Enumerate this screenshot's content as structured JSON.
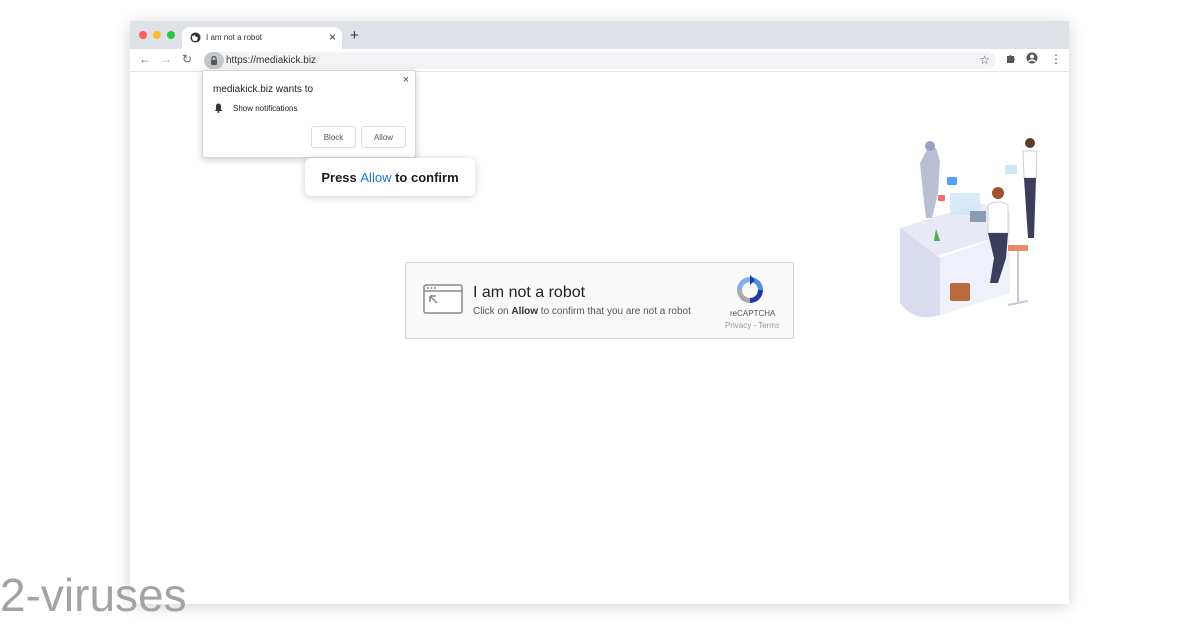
{
  "browser": {
    "tab": {
      "title": "I am not a robot",
      "globe_icon": "globe-icon",
      "close_label": "×"
    },
    "new_tab_label": "+",
    "toolbar": {
      "back_label": "←",
      "forward_label": "→",
      "reload_label": "↻",
      "url": "https://mediakick.biz",
      "star_label": "☆",
      "menu_label": "⋮"
    }
  },
  "permission_popup": {
    "close_label": "×",
    "heading": "mediakick.biz wants to",
    "permission": "Show notifications",
    "block_label": "Block",
    "allow_label": "Allow"
  },
  "press_hint": {
    "prefix": "Press ",
    "highlight": "Allow",
    "suffix": " to confirm"
  },
  "captcha": {
    "title": "I am not a robot",
    "sub_prefix": "Click on ",
    "sub_bold": "Allow",
    "sub_suffix": " to confirm that you are not a robot",
    "brand": "reCAPTCHA",
    "links": "Privacy - Terms"
  },
  "watermark": "2-viruses",
  "colors": {
    "accent": "#1a73e8",
    "titlebar": "#dee1e6",
    "captcha_bg": "#f9f9f9"
  }
}
